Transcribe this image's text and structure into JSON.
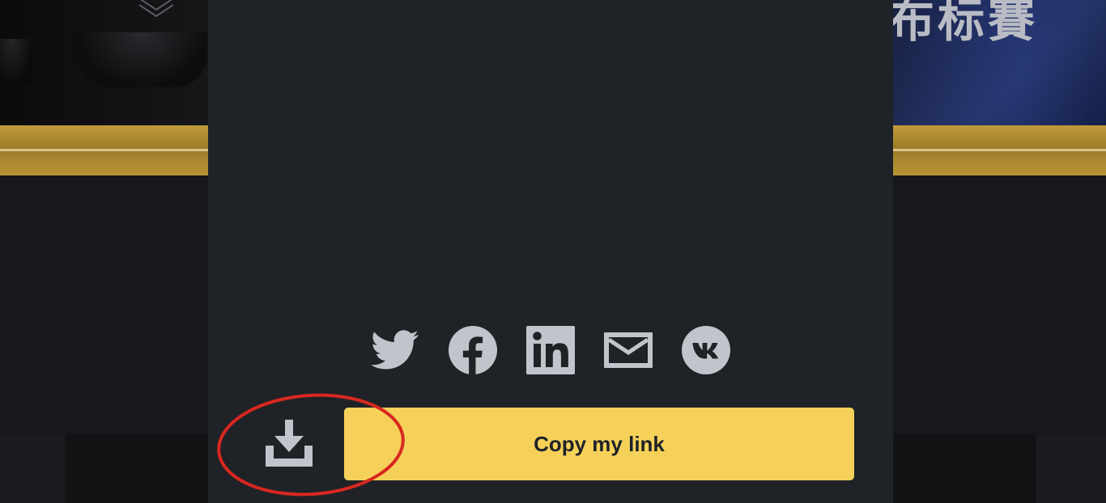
{
  "background": {
    "banner_text": "布标賽"
  },
  "share": {
    "icons": [
      "twitter-icon",
      "facebook-icon",
      "linkedin-icon",
      "email-icon",
      "vk-icon"
    ],
    "icon_color": "#c2c4cb"
  },
  "actions": {
    "download_icon": "download-icon",
    "copy_label": "Copy my link",
    "copy_color": "#f6d15a"
  },
  "annotation": {
    "color": "#d8281f",
    "shape": "ellipse around download button"
  }
}
